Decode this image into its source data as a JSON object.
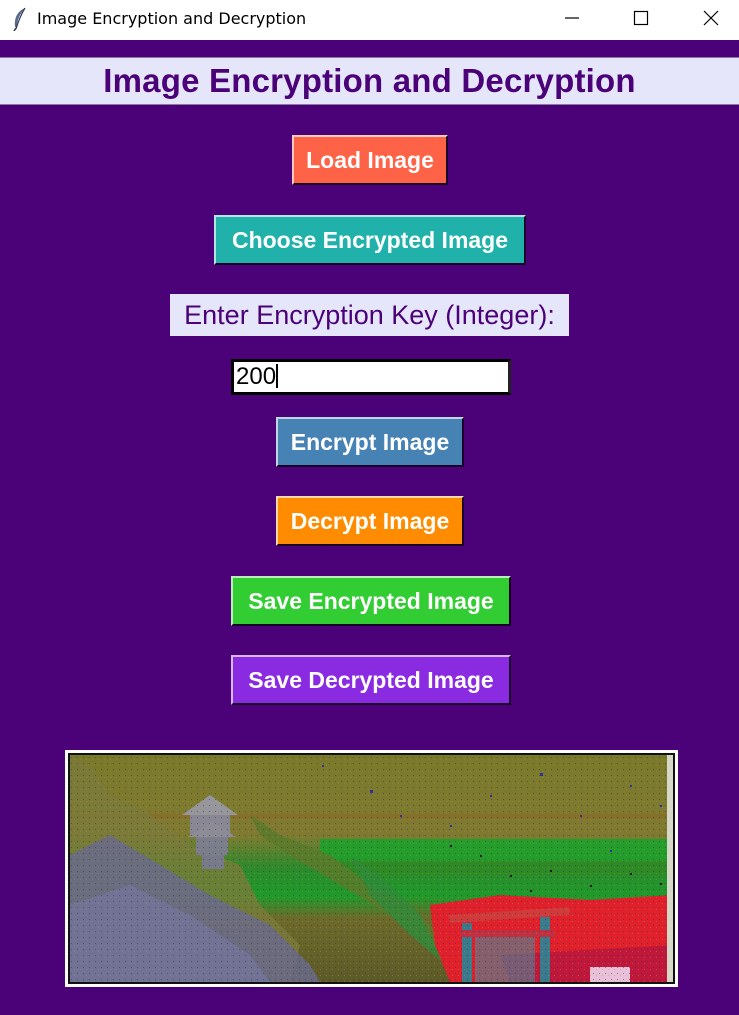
{
  "window": {
    "title": "Image Encryption and Decryption",
    "controls": {
      "minimize": "minimize-icon",
      "maximize": "maximize-icon",
      "close": "close-icon"
    }
  },
  "app": {
    "heading": "Image Encryption and Decryption",
    "buttons": {
      "load": "Load Image",
      "choose_encrypted": "Choose Encrypted Image",
      "encrypt": "Encrypt Image",
      "decrypt": "Decrypt Image",
      "save_encrypted": "Save Encrypted Image",
      "save_decrypted": "Save Decrypted Image"
    },
    "key_label": "Enter Encryption Key (Integer):",
    "key_value": "200"
  },
  "colors": {
    "background": "#4b0178",
    "label_background": "#e6e6fa",
    "load": "#ff6347",
    "choose_encrypted": "#20b2aa",
    "encrypt": "#4682b4",
    "decrypt": "#ff8c00",
    "save_encrypted": "#32cd32",
    "save_decrypted": "#8a2be2"
  }
}
